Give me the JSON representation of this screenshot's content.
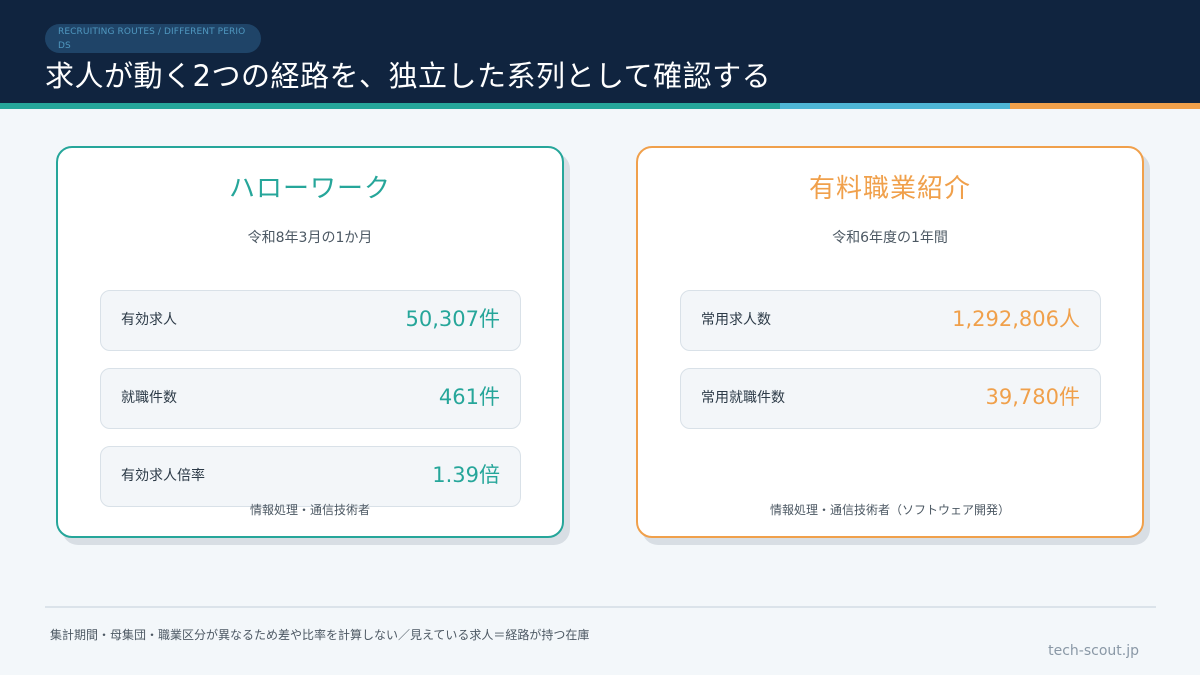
{
  "header": {
    "tag": "RECRUITING ROUTES / DIFFERENT PERIODS",
    "title": "求人が動く2つの経路を、独立した系列として確認する"
  },
  "colors": {
    "header_bg": "#10243f",
    "teal": "#26a69a",
    "blue": "#4fb6d6",
    "orange": "#f0a04b"
  },
  "cards": [
    {
      "title": "ハローワーク",
      "period": "令和8年3月の1か月",
      "metrics": [
        {
          "label": "有効求人",
          "value": "50,307件"
        },
        {
          "label": "就職件数",
          "value": "461件"
        },
        {
          "label": "有効求人倍率",
          "value": "1.39倍"
        }
      ],
      "note": "情報処理・通信技術者"
    },
    {
      "title": "有料職業紹介",
      "period": "令和6年度の1年間",
      "metrics": [
        {
          "label": "常用求人数",
          "value": "1,292,806人"
        },
        {
          "label": "常用就職件数",
          "value": "39,780件"
        }
      ],
      "note": "情報処理・通信技術者（ソフトウェア開発）"
    }
  ],
  "footer": {
    "note": "集計期間・母集団・職業区分が異なるため差や比率を計算しない／見えている求人＝経路が持つ在庫",
    "site": "tech-scout.jp"
  }
}
